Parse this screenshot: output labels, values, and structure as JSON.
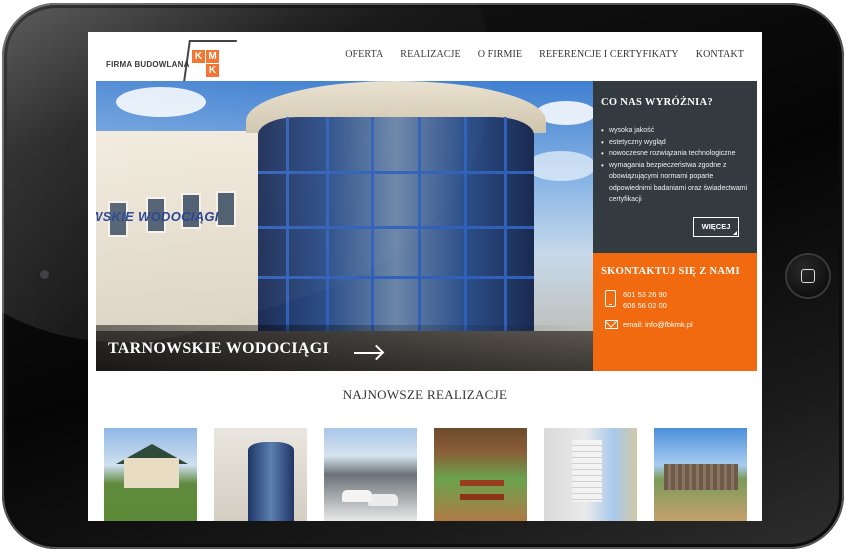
{
  "site": {
    "logo": {
      "text": "FIRMA BUDOWLANA",
      "letters": [
        "K",
        "M",
        "K"
      ]
    },
    "nav": [
      "OFERTA",
      "REALIZACJE",
      "O FIRMIE",
      "REFERENCJE I CERTYFIKATY",
      "KONTAKT"
    ]
  },
  "hero": {
    "sign_text": "WSKIE WODOCIĄGI",
    "caption": "TARNOWSKIE WODOCIĄGI"
  },
  "features_panel": {
    "title": "CO NAS WYRÓŻNIA?",
    "items": [
      "wysoka jakość",
      "estetyczny wygląd",
      "nowoczesne rozwiązania technologiczne",
      "wymagania bezpieczeństwa zgodne z obowiązującymi normami poparte odpowiednimi badaniami oraz świadectwami certyfikacji"
    ],
    "more_label": "WIĘCEJ"
  },
  "contact_panel": {
    "title": "SKONTAKTUJ SIĘ Z NAMI",
    "phones": [
      "601 53 26 90",
      "606 56 02 00"
    ],
    "email": "email: info@fbkmk.pl"
  },
  "gallery": {
    "title": "NAJNOWSZE REALIZACJE"
  },
  "colors": {
    "accent": "#f26a0f",
    "panel_dark": "#333b40",
    "nav_text": "#333333"
  }
}
